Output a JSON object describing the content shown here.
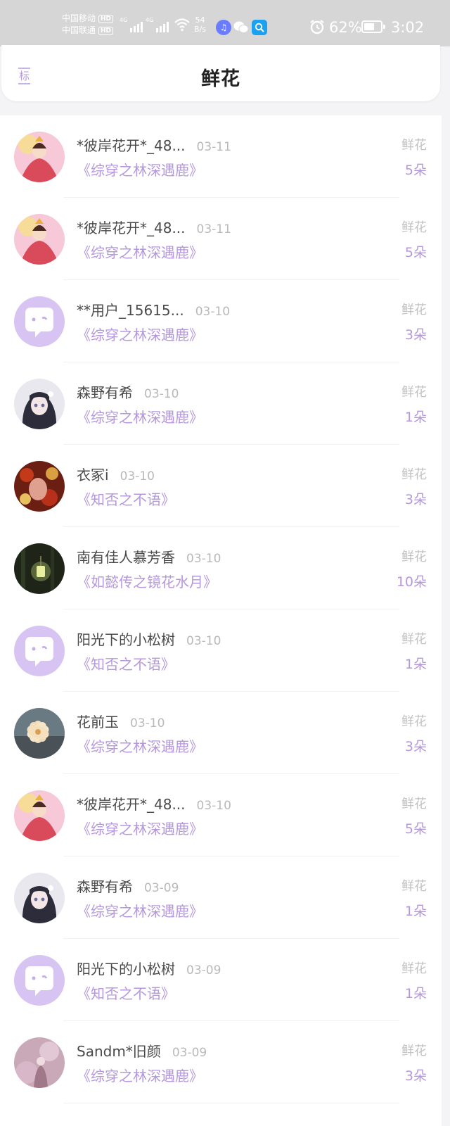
{
  "status_bar": {
    "carrier1": "中国移动",
    "carrier2": "中国联通",
    "hd_badge": "HD",
    "network1": "4G",
    "network2": "4G",
    "speed_value": "54",
    "speed_unit": "B/s",
    "battery_text": "62%",
    "battery_level": 0.62,
    "time": "3:02",
    "icons": [
      "music-app-icon",
      "wechat-icon",
      "search-app-icon",
      "alarm-icon",
      "wifi-icon",
      "battery-icon"
    ]
  },
  "header": {
    "back_label": "标",
    "title": "鲜花"
  },
  "colors": {
    "accent": "#b597dd",
    "avatar_default_bg": "#d7c4f3",
    "status_bar_bg": "#d6d6d6"
  },
  "rows": [
    {
      "name": "*彼岸花开*_48...",
      "date": "03-11",
      "book": "《综穿之林深遇鹿》",
      "type": "鲜花",
      "amount": "5朵",
      "avatar": "fairy"
    },
    {
      "name": "*彼岸花开*_48...",
      "date": "03-11",
      "book": "《综穿之林深遇鹿》",
      "type": "鲜花",
      "amount": "5朵",
      "avatar": "fairy"
    },
    {
      "name": "**用户_15615...",
      "date": "03-10",
      "book": "《综穿之林深遇鹿》",
      "type": "鲜花",
      "amount": "3朵",
      "avatar": "default"
    },
    {
      "name": "森野有希",
      "date": "03-10",
      "book": "《综穿之林深遇鹿》",
      "type": "鲜花",
      "amount": "1朵",
      "avatar": "anime"
    },
    {
      "name": "衣冢i",
      "date": "03-10",
      "book": "《知否之不语》",
      "type": "鲜花",
      "amount": "3朵",
      "avatar": "flowers"
    },
    {
      "name": "南有佳人慕芳香",
      "date": "03-10",
      "book": "《如懿传之镜花水月》",
      "type": "鲜花",
      "amount": "10朵",
      "avatar": "lantern"
    },
    {
      "name": "阳光下的小松树",
      "date": "03-10",
      "book": "《知否之不语》",
      "type": "鲜花",
      "amount": "1朵",
      "avatar": "default"
    },
    {
      "name": "花前玉",
      "date": "03-10",
      "book": "《综穿之林深遇鹿》",
      "type": "鲜花",
      "amount": "3朵",
      "avatar": "blossom"
    },
    {
      "name": "*彼岸花开*_48...",
      "date": "03-10",
      "book": "《综穿之林深遇鹿》",
      "type": "鲜花",
      "amount": "5朵",
      "avatar": "fairy"
    },
    {
      "name": "森野有希",
      "date": "03-09",
      "book": "《综穿之林深遇鹿》",
      "type": "鲜花",
      "amount": "1朵",
      "avatar": "anime"
    },
    {
      "name": "阳光下的小松树",
      "date": "03-09",
      "book": "《知否之不语》",
      "type": "鲜花",
      "amount": "1朵",
      "avatar": "default"
    },
    {
      "name": "Sandm*旧颜",
      "date": "03-09",
      "book": "《综穿之林深遇鹿》",
      "type": "鲜花",
      "amount": "3朵",
      "avatar": "pink"
    }
  ]
}
